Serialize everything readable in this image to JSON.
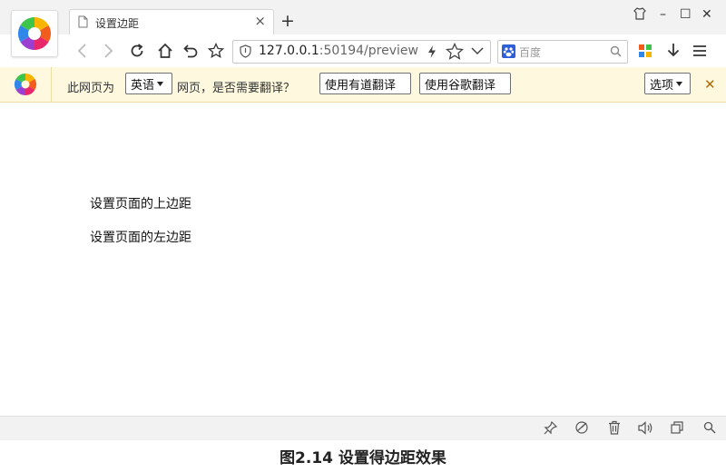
{
  "browser": {
    "tab_title": "设置边距",
    "tab_close": "×",
    "new_tab": "+",
    "window_controls": {
      "minimize": "–",
      "maximize": "☐",
      "close": "✕"
    },
    "url": {
      "host": "127.0.0.1",
      "rest": ":50194/preview"
    },
    "search_placeholder": "百度"
  },
  "translate_bar": {
    "prefix": "此网页为",
    "language": "英语",
    "question": "网页，是否需要翻译？",
    "youdao_button": "使用有道翻译",
    "google_button": "使用谷歌翻译",
    "options_button": "选项",
    "close": "✕"
  },
  "content": {
    "lines": [
      "设置页面的上边距",
      "设置页面的左边距"
    ]
  },
  "caption": "图2.14  设置得边距效果",
  "colors": {
    "translate_bar_bg": "#fef9de",
    "chrome_bg": "#f2f2f2"
  }
}
